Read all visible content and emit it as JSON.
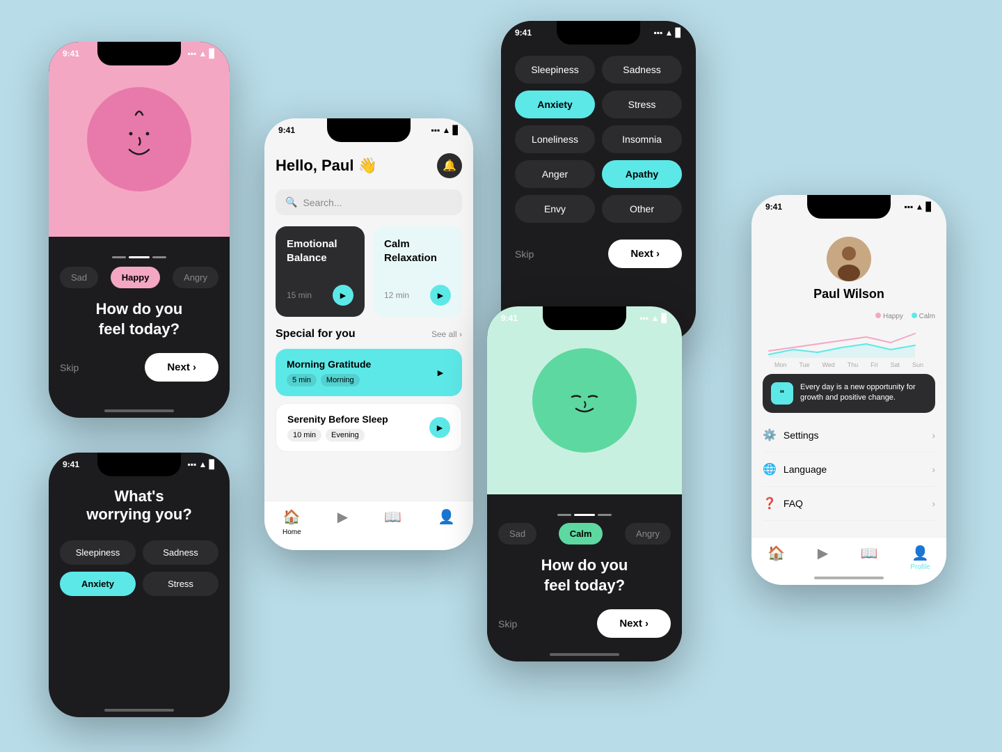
{
  "background": "#b8dce8",
  "phone1": {
    "time": "9:41",
    "moods": [
      "Sad",
      "Happy",
      "Angry"
    ],
    "activeMood": "Happy",
    "question": "How do you\nfeel today?",
    "skipLabel": "Skip",
    "nextLabel": "Next"
  },
  "phone2": {
    "time": "9:41",
    "question": "What's\nworrying you?",
    "tags": [
      {
        "label": "Sleepiness",
        "active": false
      },
      {
        "label": "Sadness",
        "active": false
      },
      {
        "label": "Anxiety",
        "active": true
      },
      {
        "label": "Stress",
        "active": false
      }
    ]
  },
  "phone3": {
    "time": "9:41",
    "greeting": "Hello, Paul 👋",
    "searchPlaceholder": "Search...",
    "featured": [
      {
        "title": "Emotional Balance",
        "time": "15 min",
        "dark": true
      },
      {
        "title": "Calm Relaxation",
        "time": "12 min",
        "dark": false
      }
    ],
    "sectionTitle": "Special for you",
    "seeAll": "See all",
    "items": [
      {
        "name": "Morning Gratitude",
        "tags": [
          "5 min",
          "Morning"
        ],
        "highlighted": true
      },
      {
        "name": "Serenity Before Sleep",
        "tags": [
          "10 min",
          "Evening"
        ],
        "highlighted": false
      }
    ],
    "nav": [
      "Home",
      "Play",
      "Book",
      "Profile"
    ]
  },
  "phone4": {
    "time": "9:41",
    "emotions": [
      {
        "label": "Sleepiness",
        "active": false
      },
      {
        "label": "Sadness",
        "active": false
      },
      {
        "label": "Anxiety",
        "active": true
      },
      {
        "label": "Stress",
        "active": false
      },
      {
        "label": "Loneliness",
        "active": false
      },
      {
        "label": "Insomnia",
        "active": false
      },
      {
        "label": "Anger",
        "active": false
      },
      {
        "label": "Apathy",
        "active": true
      },
      {
        "label": "Envy",
        "active": false
      },
      {
        "label": "Other",
        "active": false
      }
    ],
    "skipLabel": "Skip",
    "nextLabel": "Next"
  },
  "phone5": {
    "time": "9:41",
    "moods": [
      "Sad",
      "Calm",
      "Angry"
    ],
    "activeMood": "Calm",
    "question": "How do you\nfeel today?",
    "skipLabel": "Skip",
    "nextLabel": "Next"
  },
  "phone6": {
    "time": "9:41",
    "name": "Paul Wilson",
    "chartDays": [
      "Mon",
      "Tue",
      "Wed",
      "Thu",
      "Fri",
      "Sat",
      "Sun"
    ],
    "legend": [
      {
        "label": "Happy",
        "color": "#f4a7c3"
      },
      {
        "label": "Calm",
        "color": "#5de8e8"
      }
    ],
    "quote": "Every day is a new opportunity for growth and positive change.",
    "settings": [
      {
        "icon": "⚙️",
        "label": "Settings"
      },
      {
        "icon": "🌐",
        "label": "Language"
      },
      {
        "icon": "❓",
        "label": "FAQ"
      }
    ],
    "nav": [
      "Home",
      "Play",
      "Book",
      "Profile"
    ]
  }
}
